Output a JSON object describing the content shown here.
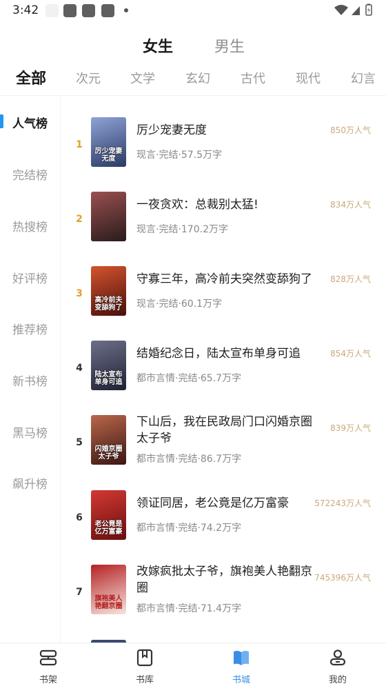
{
  "status_bar": {
    "time": "3:42"
  },
  "gender_tabs": [
    {
      "label": "女生",
      "active": true
    },
    {
      "label": "男生",
      "active": false
    }
  ],
  "category_tabs": [
    {
      "label": "全部",
      "active": true
    },
    {
      "label": "次元"
    },
    {
      "label": "文学"
    },
    {
      "label": "玄幻"
    },
    {
      "label": "古代"
    },
    {
      "label": "现代"
    },
    {
      "label": "幻言"
    }
  ],
  "ranking_sidebar": [
    {
      "label": "人气榜",
      "active": true
    },
    {
      "label": "完结榜"
    },
    {
      "label": "热搜榜"
    },
    {
      "label": "好评榜"
    },
    {
      "label": "推荐榜"
    },
    {
      "label": "新书榜"
    },
    {
      "label": "黑马榜"
    },
    {
      "label": "飙升榜"
    }
  ],
  "books": [
    {
      "rank": "1",
      "title": "厉少宠妻无度",
      "meta": "现言·完结·57.5万字",
      "popularity": "850万人气",
      "cover_text": "厉少宠妻无度",
      "cover_colors": [
        "#2b3a66",
        "#8fa3d6"
      ]
    },
    {
      "rank": "2",
      "title": "一夜贪欢：总裁别太猛!",
      "meta": "现言·完结·170.2万字",
      "popularity": "834万人气",
      "cover_text": "",
      "cover_colors": [
        "#2a1b1b",
        "#9a5050"
      ]
    },
    {
      "rank": "3",
      "title": "守寡三年，高冷前夫突然变舔狗了",
      "meta": "现言·完结·60.1万字",
      "popularity": "828万人气",
      "cover_text": "高冷前夫变舔狗了",
      "cover_colors": [
        "#4a0f0a",
        "#d4542e"
      ]
    },
    {
      "rank": "4",
      "title": "结婚纪念日，陆太宣布单身可追",
      "meta": "都市言情·完结·65.7万字",
      "popularity": "854万人气",
      "cover_text": "陆太宣布单身可追",
      "cover_colors": [
        "#1e2233",
        "#6d6f8a"
      ]
    },
    {
      "rank": "5",
      "title": "下山后，我在民政局门口闪婚京圈太子爷",
      "meta": "都市言情·完结·86.7万字",
      "popularity": "839万人气",
      "cover_text": "闪婚京圈太子爷",
      "cover_colors": [
        "#3b1612",
        "#b9674b"
      ]
    },
    {
      "rank": "6",
      "title": "领证同居，老公竟是亿万富豪",
      "meta": "都市言情·完结·74.2万字",
      "popularity": "572243万人气",
      "cover_text": "老公竟是亿万富豪",
      "cover_colors": [
        "#6b0d10",
        "#d23a32"
      ]
    },
    {
      "rank": "7",
      "title": "改嫁疯批太子爷，旗袍美人艳翻京圈",
      "meta": "都市言情·完结·71.4万字",
      "popularity": "745396万人气",
      "cover_text": "旗袍美人艳翻京圈",
      "cover_colors": [
        "#f4e6e2",
        "#b52222"
      ]
    }
  ],
  "bottom_nav": [
    {
      "label": "书架",
      "icon": "bookshelf-icon",
      "active": false
    },
    {
      "label": "书库",
      "icon": "library-icon",
      "active": false
    },
    {
      "label": "书城",
      "icon": "bookstore-icon",
      "active": true
    },
    {
      "label": "我的",
      "icon": "profile-icon",
      "active": false
    }
  ],
  "colors": {
    "accent": "#3a8ee6",
    "rank_gold": "#e0a02a",
    "popularity": "#c9a97a",
    "sidebar_indicator": "#2196f3"
  }
}
